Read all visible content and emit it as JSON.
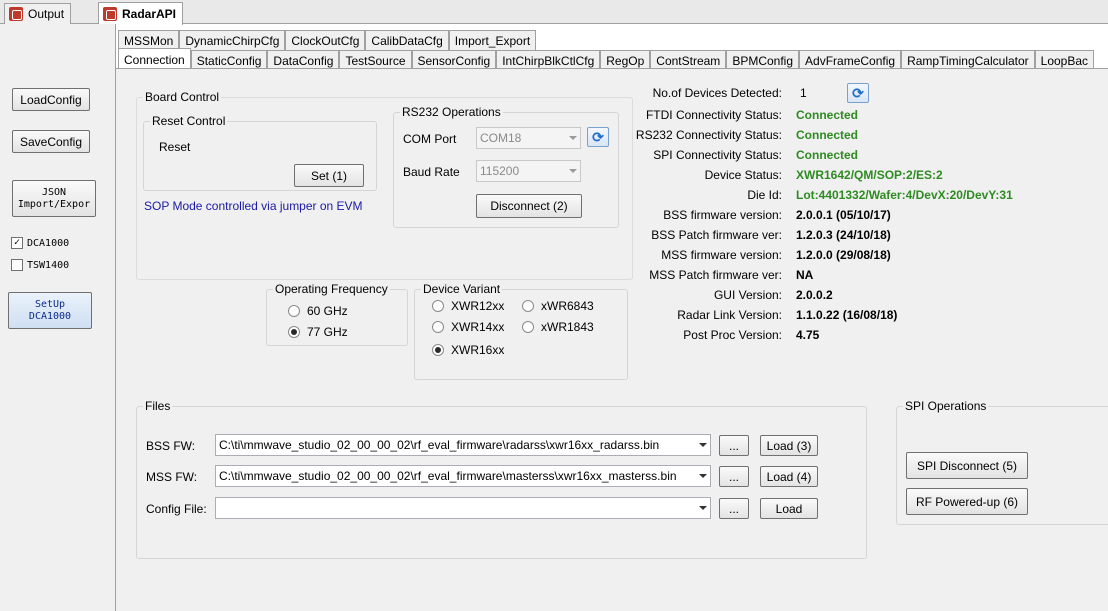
{
  "doc_tabs": [
    {
      "label": "Output"
    },
    {
      "label": "RadarAPI"
    }
  ],
  "left_panel": {
    "load_config": "LoadConfig",
    "save_config": "SaveConfig",
    "json_line1": "JSON",
    "json_line2": "Import/Expor",
    "dca1000": "DCA1000",
    "tsw1400": "TSW1400",
    "setup_line1": "SetUp",
    "setup_line2": "DCA1000"
  },
  "tabs_top": [
    "MSSMon",
    "DynamicChirpCfg",
    "ClockOutCfg",
    "CalibDataCfg",
    "Import_Export"
  ],
  "tabs_bottom": [
    "Connection",
    "StaticConfig",
    "DataConfig",
    "TestSource",
    "SensorConfig",
    "IntChirpBlkCtlCfg",
    "RegOp",
    "ContStream",
    "BPMConfig",
    "AdvFrameConfig",
    "RampTimingCalculator",
    "LoopBac"
  ],
  "board": {
    "title": "Board Control",
    "reset_title": "Reset Control",
    "reset_label": "Reset",
    "set_button": "Set (1)",
    "sop_note": "SOP Mode controlled via jumper on EVM"
  },
  "rs232": {
    "title": "RS232 Operations",
    "com_label": "COM Port",
    "com_value": "COM18",
    "baud_label": "Baud Rate",
    "baud_value": "115200",
    "disconnect": "Disconnect (2)"
  },
  "freq": {
    "title": "Operating Frequency",
    "opt60": "60 GHz",
    "opt77": "77 GHz"
  },
  "variant": {
    "title": "Device Variant",
    "xwr12": "XWR12xx",
    "xwr14": "XWR14xx",
    "xwr16": "XWR16xx",
    "x6843": "xWR6843",
    "x1843": "xWR1843"
  },
  "status": {
    "devices_label": "No.of Devices Detected:",
    "devices_value": "1",
    "ftdi_label": "FTDI Connectivity Status:",
    "ftdi_value": "Connected",
    "rs232_label": "RS232 Connectivity Status:",
    "rs232_value": "Connected",
    "spi_label": "SPI Connectivity Status:",
    "spi_value": "Connected",
    "device_status_label": "Device Status:",
    "device_status_value": "XWR1642/QM/SOP:2/ES:2",
    "die_label": "Die Id:",
    "die_value": "Lot:4401332/Wafer:4/DevX:20/DevY:31",
    "bss_fw_label": "BSS firmware version:",
    "bss_fw_value": "2.0.0.1 (05/10/17)",
    "bss_patch_label": "BSS Patch firmware ver:",
    "bss_patch_value": "1.2.0.3 (24/10/18)",
    "mss_fw_label": "MSS firmware version:",
    "mss_fw_value": "1.2.0.0 (29/08/18)",
    "mss_patch_label": "MSS Patch firmware ver:",
    "mss_patch_value": "NA",
    "gui_label": "GUI Version:",
    "gui_value": "2.0.0.2",
    "link_label": "Radar Link Version:",
    "link_value": "1.1.0.22 (16/08/18)",
    "post_label": "Post Proc Version:",
    "post_value": "4.75"
  },
  "files": {
    "title": "Files",
    "bss_label": "BSS FW:",
    "bss_path": "C:\\ti\\mmwave_studio_02_00_00_02\\rf_eval_firmware\\radarss\\xwr16xx_radarss.bin",
    "bss_load": "Load (3)",
    "mss_label": "MSS FW:",
    "mss_path": "C:\\ti\\mmwave_studio_02_00_00_02\\rf_eval_firmware\\masterss\\xwr16xx_masterss.bin",
    "mss_load": "Load (4)",
    "cfg_label": "Config File:",
    "cfg_path": "",
    "cfg_load": "Load",
    "browse": "..."
  },
  "spi": {
    "title": "SPI Operations",
    "disconnect": "SPI Disconnect (5)",
    "rf_power": "RF Powered-up (6)"
  }
}
